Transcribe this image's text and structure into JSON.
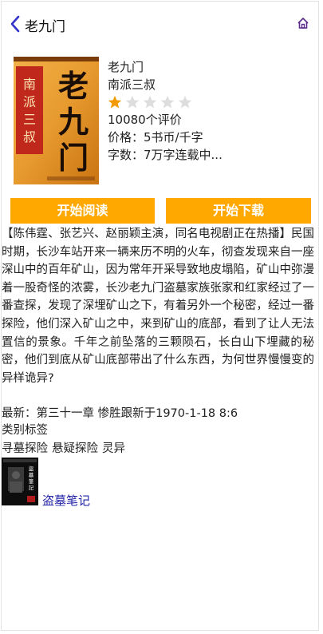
{
  "header": {
    "title": "老九门",
    "back_icon": "chevron-left-icon",
    "home_icon": "home-icon",
    "accent_color": "#3333cc"
  },
  "book": {
    "cover_main_title": "老九门",
    "cover_author_vertical": "南派三叔",
    "title": "老九门",
    "author": "南派三叔",
    "rating": 1,
    "rating_max": 5,
    "review_count": "10080个评价",
    "price": "价格：5书币/千字",
    "words": "字数：7万字连载中..."
  },
  "buttons": {
    "read": "开始阅读",
    "download": "开始下载",
    "color": "#ffa800"
  },
  "description": "【陈伟霆、张艺兴、赵丽颖主演，同名电视剧正在热播】民国时期，长沙车站开来一辆来历不明的火车，彻查发现来自一座深山中的百年矿山，因为常年开采导致地皮塌陷，矿山中弥漫着一股奇怪的浓雾，长沙老九门盗墓家族张家和红家经过了一番查探，发现了深埋矿山之下，有着另外一个秘密，经过一番探险，他们深入矿山之中，来到矿山的底部，看到了让人无法置信的景象。千年之前坠落的三颗陨石，长白山下埋藏的秘密，他们到底从矿山底部带出了什么东西，为何世界慢慢变的异样诡异?",
  "latest": "最新：第三十一章 惨胜跟新于1970-1-18 8:6",
  "tags_title": "类别标签",
  "tags": [
    "寻墓探险",
    "悬疑探险",
    "灵异"
  ],
  "related": {
    "title": "盗墓笔记",
    "cover_text": "盜墓筆記"
  }
}
